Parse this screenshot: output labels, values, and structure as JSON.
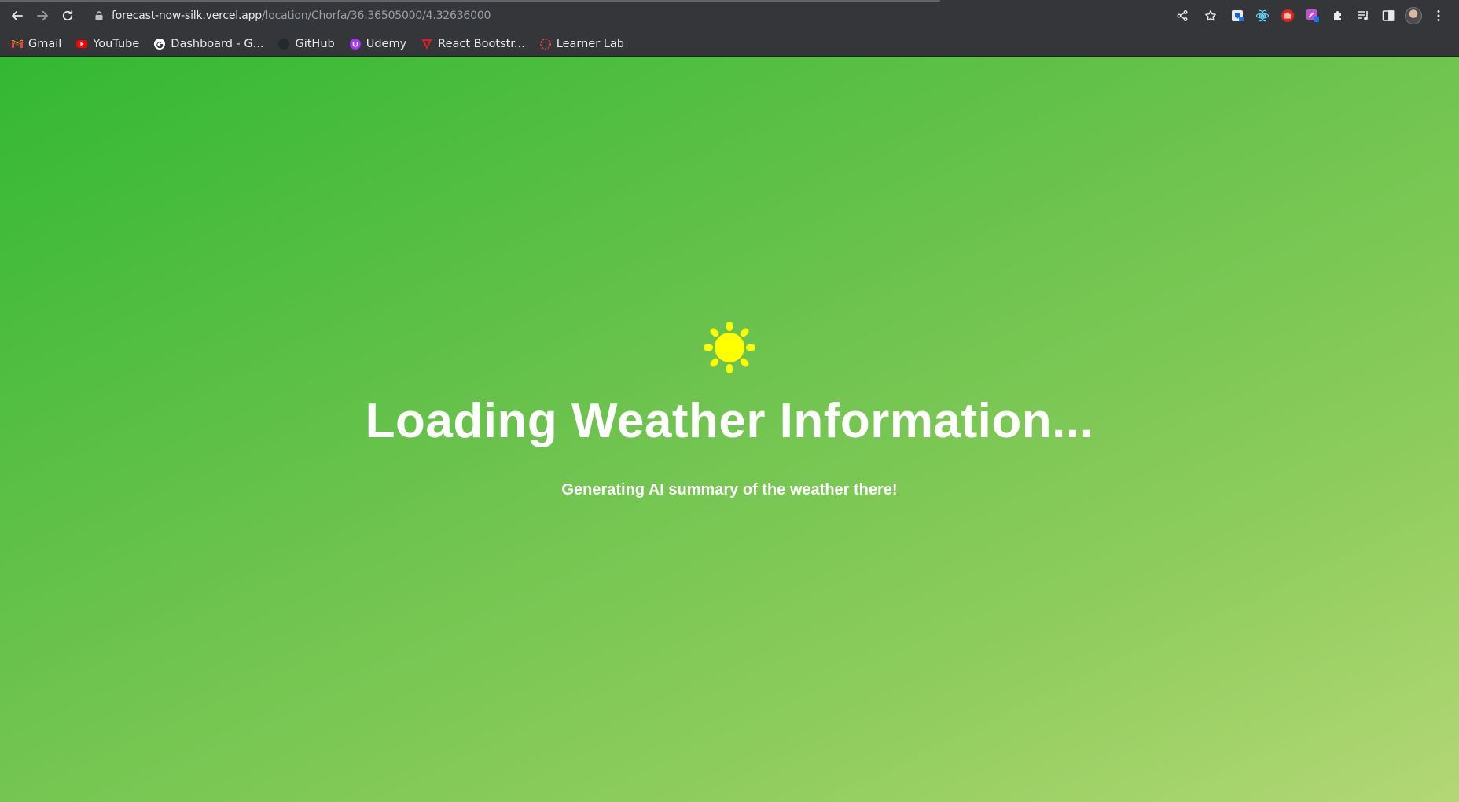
{
  "browser": {
    "url_host": "forecast-now-silk.vercel.app",
    "url_path": "/location/Chorfa/36.36505000/4.32636000",
    "bookmarks": [
      {
        "label": "Gmail",
        "icon": "gmail-icon",
        "color": "#ea4335"
      },
      {
        "label": "YouTube",
        "icon": "youtube-icon",
        "color": "#ff0000"
      },
      {
        "label": "Dashboard - G...",
        "icon": "google-icon",
        "color": "#ffffff"
      },
      {
        "label": "GitHub",
        "icon": "github-icon",
        "color": "#24292f"
      },
      {
        "label": "Udemy",
        "icon": "udemy-icon",
        "color": "#a435f0"
      },
      {
        "label": "React Bootstr...",
        "icon": "react-bootstrap-icon",
        "color": "#e31b23"
      },
      {
        "label": "Learner Lab",
        "icon": "learner-lab-icon",
        "color": "#ea4335"
      }
    ]
  },
  "page": {
    "icon": "sun-icon",
    "icon_color": "#ffff00",
    "title": "Loading Weather Information...",
    "subtitle": "Generating AI summary of the weather there!",
    "background_colors": [
      "#33b833",
      "#b3d776"
    ]
  }
}
